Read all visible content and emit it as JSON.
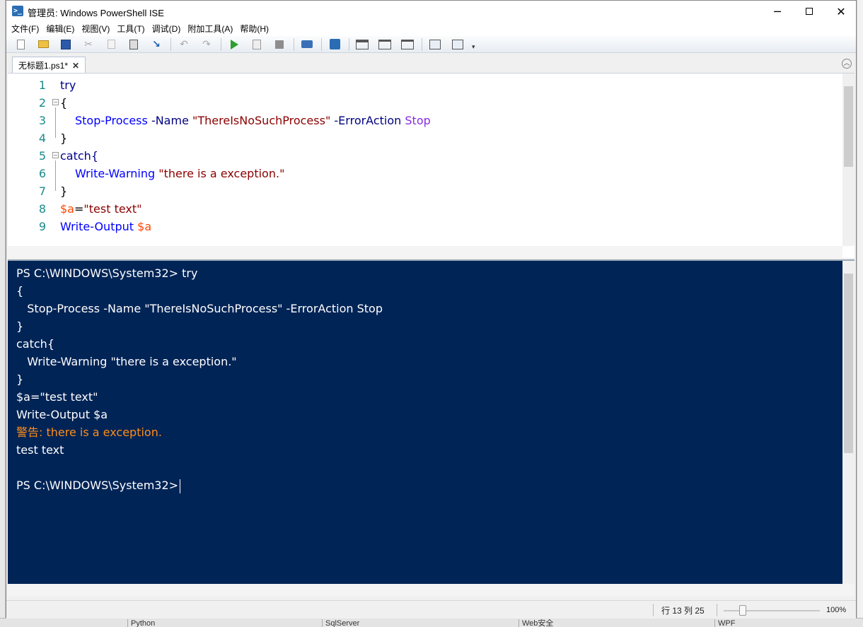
{
  "window": {
    "title": "管理员: Windows PowerShell ISE",
    "app_icon": "powershell-icon"
  },
  "menu": [
    "文件(F)",
    "编辑(E)",
    "视图(V)",
    "工具(T)",
    "调试(D)",
    "附加工具(A)",
    "帮助(H)"
  ],
  "toolbar_icons": [
    "new-icon",
    "open-icon",
    "save-icon",
    "cut-icon",
    "copy-icon",
    "paste-icon",
    "clear-icon",
    "undo-icon",
    "redo-icon",
    "run-icon",
    "run-selection-icon",
    "stop-icon",
    "remote-icon",
    "powershell-tab-icon",
    "layout-icon",
    "split-vertical-icon",
    "split-horizontal-icon",
    "show-script-icon",
    "show-command-icon"
  ],
  "tab": {
    "label": "无标题1.ps1*",
    "close": "✕"
  },
  "editor": {
    "line_numbers": [
      "1",
      "2",
      "3",
      "4",
      "5",
      "6",
      "7",
      "8",
      "9"
    ],
    "line1": "try",
    "line2": "{",
    "line3_cmd": "Stop-Process",
    "line3_p1": "-Name",
    "line3_s1": "\"ThereIsNoSuchProcess\"",
    "line3_p2": "-ErrorAction",
    "line3_arg": "Stop",
    "line4": "}",
    "line5": "catch{",
    "line6_cmd": "Write-Warning",
    "line6_str": "\"there is a exception.\"",
    "line7": "}",
    "line8_var": "$a",
    "line8_eq": "=",
    "line8_str": "\"test text\"",
    "line9_cmd": "Write-Output",
    "line9_var": "$a"
  },
  "console": {
    "lines": [
      "PS C:\\WINDOWS\\System32> try",
      "{",
      "   Stop-Process -Name \"ThereIsNoSuchProcess\" -ErrorAction Stop",
      "}",
      "catch{",
      "   Write-Warning \"there is a exception.\"",
      "}",
      "$a=\"test text\"",
      "Write-Output $a",
      "警告: there is a exception.",
      "test text",
      "",
      "PS C:\\WINDOWS\\System32>"
    ]
  },
  "status": {
    "position": "行 13 列 25",
    "zoom": "100%"
  },
  "taskbar_tabs": [
    "Python",
    "SqlServer",
    "Web安全",
    "WPF"
  ],
  "colors": {
    "console_bg": "#012456",
    "warning": "#ff8c1a",
    "line_number": "#1b8a8a"
  }
}
